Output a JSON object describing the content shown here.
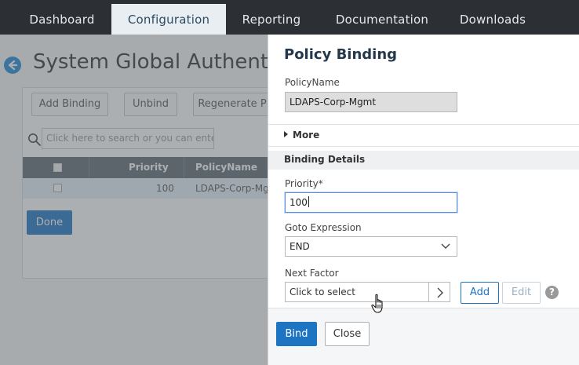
{
  "topnav": {
    "tabs": [
      {
        "label": "Dashboard"
      },
      {
        "label": "Configuration",
        "active": true
      },
      {
        "label": "Reporting"
      },
      {
        "label": "Documentation"
      },
      {
        "label": "Downloads"
      }
    ]
  },
  "background_page": {
    "title": "System Global Authentica",
    "buttons": {
      "add_binding": "Add Binding",
      "unbind": "Unbind",
      "regenerate": "Regenerate P"
    },
    "search_placeholder": "Click here to search or you can enter",
    "table": {
      "headers": [
        "Priority",
        "PolicyName"
      ],
      "rows": [
        {
          "priority": "100",
          "policy_name": "LDAPS-Corp-Mgmt"
        }
      ]
    },
    "done_label": "Done"
  },
  "panel": {
    "title": "Policy Binding",
    "policy_name_label": "PolicyName",
    "policy_name_value": "LDAPS-Corp-Mgmt",
    "more_label": "More",
    "binding_details_label": "Binding Details",
    "priority_label": "Priority*",
    "priority_value": "100",
    "goto_label": "Goto Expression",
    "goto_value": "END",
    "next_factor_label": "Next Factor",
    "next_factor_placeholder": "Click to select",
    "add_label": "Add",
    "edit_label": "Edit",
    "help_glyph": "?",
    "bind_label": "Bind",
    "close_label": "Close"
  },
  "colors": {
    "primary": "#1d74c2",
    "nav_bg": "#2c2f33",
    "active_tab_bg": "#e9eef2",
    "table_header": "#5e6873"
  }
}
